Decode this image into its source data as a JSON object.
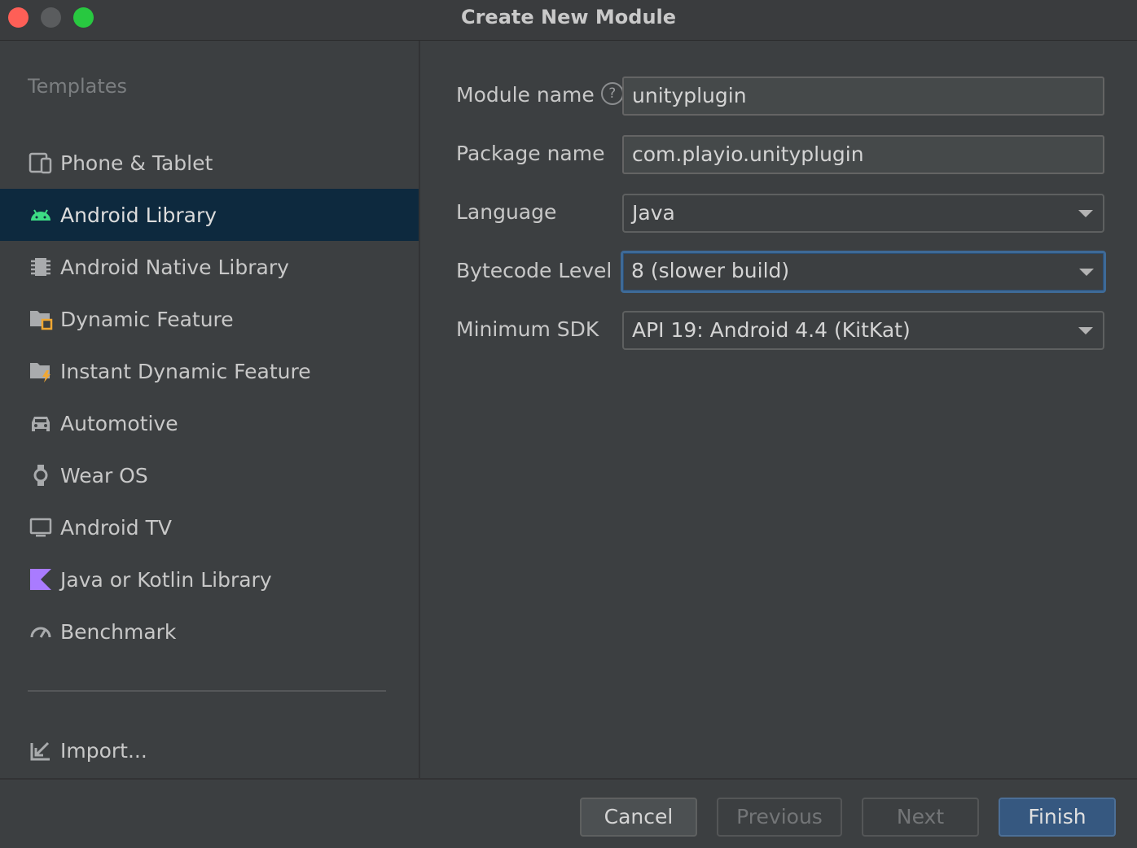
{
  "window": {
    "title": "Create New Module"
  },
  "sidebar": {
    "heading": "Templates",
    "items": [
      {
        "label": "Phone & Tablet",
        "icon": "phone-tablet-icon"
      },
      {
        "label": "Android Library",
        "icon": "android-icon",
        "selected": true
      },
      {
        "label": "Android Native Library",
        "icon": "native-library-icon"
      },
      {
        "label": "Dynamic Feature",
        "icon": "dynamic-feature-icon"
      },
      {
        "label": "Instant Dynamic Feature",
        "icon": "instant-feature-icon"
      },
      {
        "label": "Automotive",
        "icon": "car-icon"
      },
      {
        "label": "Wear OS",
        "icon": "watch-icon"
      },
      {
        "label": "Android TV",
        "icon": "tv-icon"
      },
      {
        "label": "Java or Kotlin Library",
        "icon": "kotlin-icon"
      },
      {
        "label": "Benchmark",
        "icon": "gauge-icon"
      }
    ],
    "import_label": "Import..."
  },
  "form": {
    "module_name": {
      "label": "Module name",
      "value": "unityplugin",
      "help": "?"
    },
    "package_name": {
      "label": "Package name",
      "value": "com.playio.unityplugin"
    },
    "language": {
      "label": "Language",
      "value": "Java"
    },
    "bytecode_level": {
      "label": "Bytecode Level",
      "value": "8 (slower build)"
    },
    "minimum_sdk": {
      "label": "Minimum SDK",
      "value": "API 19: Android 4.4 (KitKat)"
    }
  },
  "footer": {
    "cancel": "Cancel",
    "previous": "Previous",
    "next": "Next",
    "finish": "Finish"
  },
  "colors": {
    "selected_bg": "#0d293e",
    "android_green": "#3ddc84",
    "kotlin_purple": "#a97bff",
    "finish_blue": "#365880",
    "focus_border": "#3e6a97"
  }
}
